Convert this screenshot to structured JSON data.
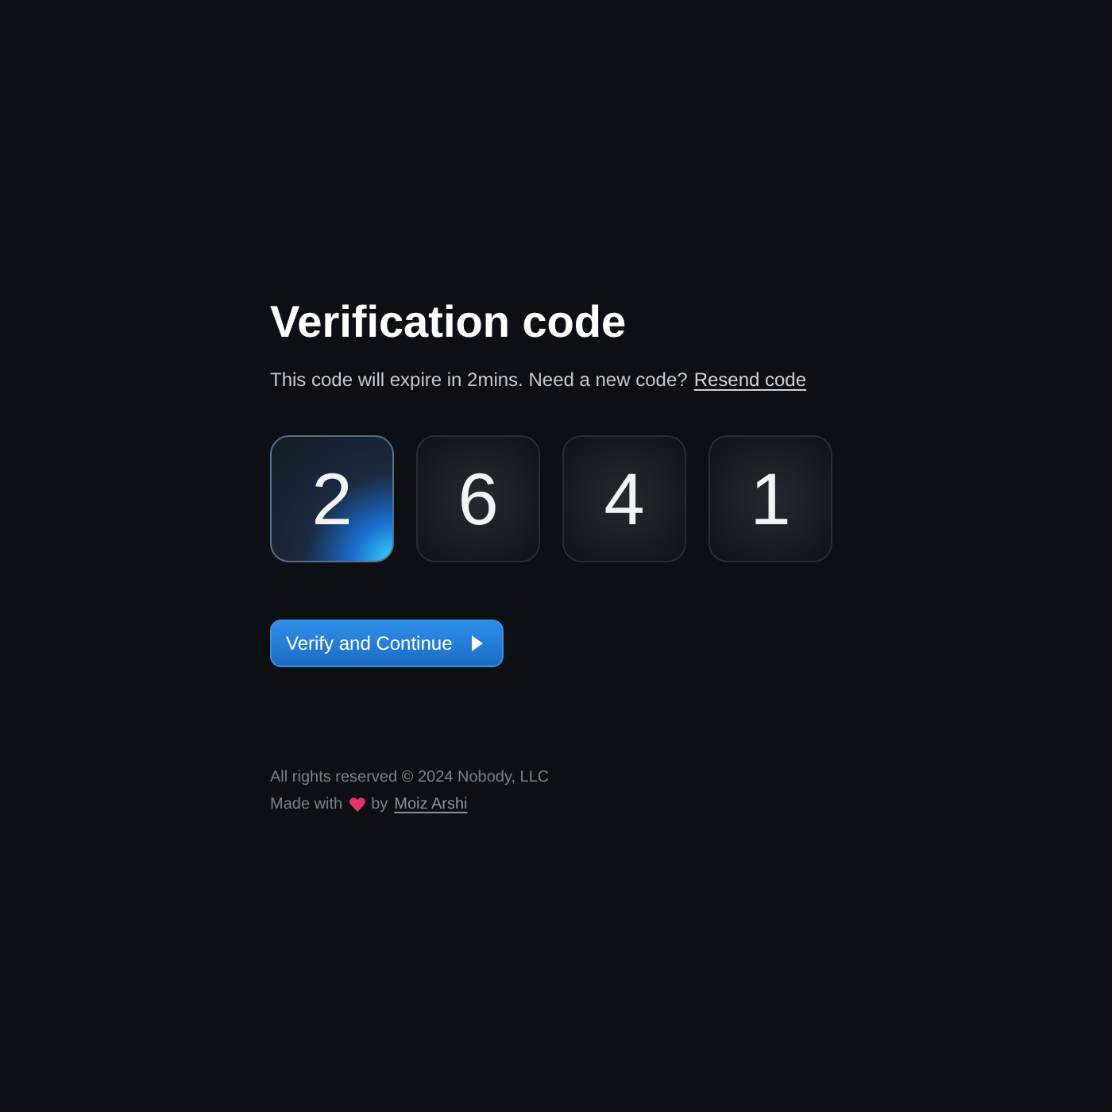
{
  "title": "Verification code",
  "subtitle": "This code will expire in 2mins. Need a new code?",
  "resend_link": "Resend code",
  "digits": [
    {
      "value": "2",
      "selected": true
    },
    {
      "value": "6",
      "selected": false
    },
    {
      "value": "4",
      "selected": false
    },
    {
      "value": "1",
      "selected": false
    }
  ],
  "button": {
    "label": "Verify and Continue"
  },
  "footer": {
    "copyright": "All rights reserved © 2024 Nobody, LLC",
    "made_with": "Made with",
    "by": "by",
    "author_link": "Moiz Arshi"
  }
}
